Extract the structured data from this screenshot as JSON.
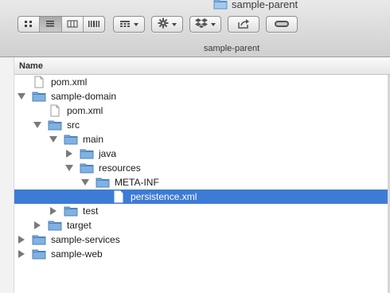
{
  "window": {
    "title": "sample-parent",
    "caption": "sample-parent"
  },
  "toolbar": {
    "view_modes": [
      {
        "name": "icon-view",
        "icon": "grid-icon",
        "active": false
      },
      {
        "name": "list-view",
        "icon": "list-icon",
        "active": true
      },
      {
        "name": "column-view",
        "icon": "columns-icon",
        "active": false
      },
      {
        "name": "coverflow-view",
        "icon": "coverflow-icon",
        "active": false
      }
    ],
    "arrange_icon": "arrange-grid-icon",
    "action_icon": "gear-icon",
    "dropbox_icon": "dropbox-icon",
    "share_icon": "share-icon",
    "tag_icon": "toggle-pill-icon"
  },
  "list": {
    "column_header": "Name",
    "accent_color": "#3d7bd6",
    "folder_color": "#7fb1e3",
    "rows": [
      {
        "label": "pom.xml",
        "type": "file",
        "depth": 0,
        "disclosure": "none",
        "selected": false
      },
      {
        "label": "sample-domain",
        "type": "folder",
        "depth": 0,
        "disclosure": "open",
        "selected": false
      },
      {
        "label": "pom.xml",
        "type": "file",
        "depth": 1,
        "disclosure": "none",
        "selected": false
      },
      {
        "label": "src",
        "type": "folder",
        "depth": 1,
        "disclosure": "open",
        "selected": false
      },
      {
        "label": "main",
        "type": "folder",
        "depth": 2,
        "disclosure": "open",
        "selected": false
      },
      {
        "label": "java",
        "type": "folder",
        "depth": 3,
        "disclosure": "closed",
        "selected": false
      },
      {
        "label": "resources",
        "type": "folder",
        "depth": 3,
        "disclosure": "open",
        "selected": false
      },
      {
        "label": "META-INF",
        "type": "folder",
        "depth": 4,
        "disclosure": "open",
        "selected": false
      },
      {
        "label": "persistence.xml",
        "type": "file",
        "depth": 5,
        "disclosure": "none",
        "selected": true
      },
      {
        "label": "test",
        "type": "folder",
        "depth": 2,
        "disclosure": "closed",
        "selected": false
      },
      {
        "label": "target",
        "type": "folder",
        "depth": 1,
        "disclosure": "closed",
        "selected": false
      },
      {
        "label": "sample-services",
        "type": "folder",
        "depth": 0,
        "disclosure": "closed",
        "selected": false
      },
      {
        "label": "sample-web",
        "type": "folder",
        "depth": 0,
        "disclosure": "closed",
        "selected": false
      }
    ]
  }
}
